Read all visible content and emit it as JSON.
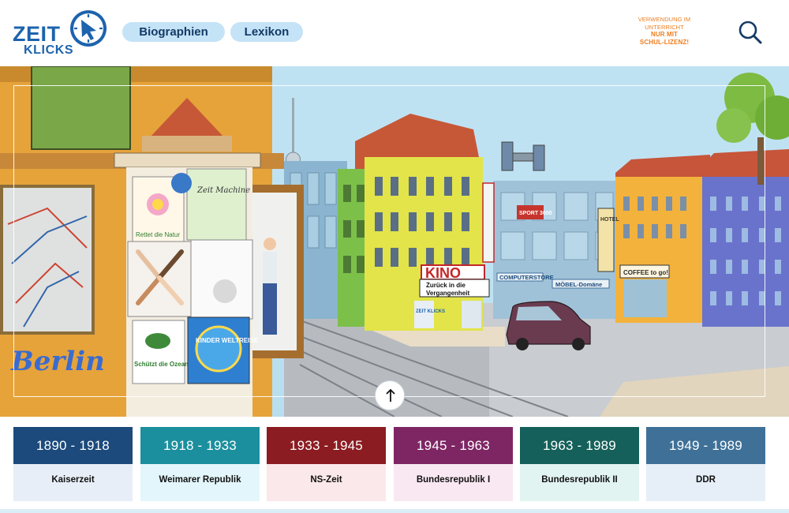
{
  "header": {
    "logo": {
      "line1": "ZEIT",
      "line2": "KLICKS",
      "icon": "clock-cursor-icon"
    },
    "nav": [
      {
        "label": "Biographien"
      },
      {
        "label": "Lexikon"
      }
    ],
    "license": {
      "line1": "VERWENDUNG IM",
      "line2": "UNTERRICHT",
      "line3": "NUR MIT",
      "line4": "SCHUL-LIZENZ!"
    },
    "search_icon": "search-icon"
  },
  "hero": {
    "signs": {
      "kino": "KINO",
      "kino_banner1": "Zurück in die",
      "kino_banner2": "Vergangenheit",
      "hotel": "HOTEL",
      "coffee": "COFFEE to go!",
      "computer": "COMPUTERSTORE",
      "moebel": "MÖBEL-Domäne",
      "sport": "SPORT 3000",
      "zeit": "ZEIT KLICKS",
      "berlin": "Berlin",
      "poster_nature": "Rettet die Natur",
      "poster_ocean": "Schützt die Ozeane",
      "poster_kinder": "KINDER WELTREISE",
      "poster_zeit": "Zeit Machine"
    },
    "scroll_icon": "arrow-up-icon"
  },
  "colors": {
    "brand_blue": "#1d63ad",
    "pill_bg": "#c4e3f7",
    "license_orange": "#ef7d1d"
  },
  "eras": [
    {
      "years": "1890 - 1918",
      "name": "Kaiserzeit",
      "color": "#1c4a7c",
      "tint": "#e7eef7"
    },
    {
      "years": "1918 - 1933",
      "name": "Weimarer Republik",
      "color": "#1b8f9e",
      "tint": "#e3f6fb"
    },
    {
      "years": "1933 - 1945",
      "name": "NS-Zeit",
      "color": "#8b1c21",
      "tint": "#fbe8ea"
    },
    {
      "years": "1945 - 1963",
      "name": "Bundesrepublik I",
      "color": "#7e2564",
      "tint": "#f9e8f2"
    },
    {
      "years": "1963 - 1989",
      "name": "Bundesrepublik II",
      "color": "#15605a",
      "tint": "#e2f4f2"
    },
    {
      "years": "1949 - 1989",
      "name": "DDR",
      "color": "#3f7198",
      "tint": "#e6eff7"
    }
  ]
}
